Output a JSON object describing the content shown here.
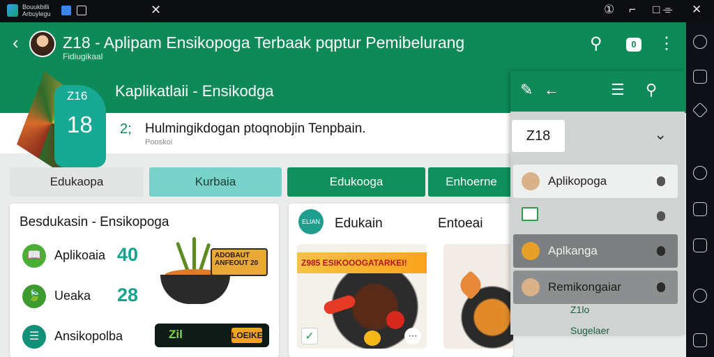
{
  "os": {
    "logo_text": "Bouukbilli Arbuylegu",
    "buttons": [
      "①",
      "⌐",
      "□ ⌯",
      "✕"
    ],
    "tab_close": "✕"
  },
  "appbar": {
    "title": "Z18 - Aplipam Ensikopoga Terbaak pqptur Pemibelurang",
    "subtitle": "Fidiugikaal",
    "badge": "0"
  },
  "banner": {
    "title": "Kaplikatlaii - Ensikodga",
    "hero_card_top": "Z16",
    "hero_card_number": "18"
  },
  "infocard": {
    "number": "2;",
    "text": "Hulmingikdogan ptoqnobjin Tenpbain.",
    "sub": "Pooskoi"
  },
  "tabs": [
    "Edukaopa",
    "Kurbaia",
    "Edukooga",
    "Enhoerne"
  ],
  "left_panel": {
    "title": "Besdukasin - Ensikopoga",
    "rows": [
      {
        "label": "Aplikoaia",
        "value": "40",
        "icon": "📖"
      },
      {
        "label": "Ueaka",
        "value": "28",
        "icon": "🍃"
      },
      {
        "label": "Ansikopolba",
        "value": "",
        "icon": "☰"
      }
    ],
    "sign1": "ADOBAUT ANFEOUT 20",
    "sign2_left": "Zil",
    "sign2_right": "LOEIKE"
  },
  "mid_panel": {
    "icon_text": "ELIAN",
    "title": "Edukain",
    "title2": "Entoeai",
    "banner_strip": "Z985 ESIKOOOGATARKEI!",
    "check": "✓",
    "bubble": "⋯"
  },
  "drawer": {
    "chip": "Z18",
    "items": [
      {
        "label": "Aplikopoga"
      },
      {
        "label": ""
      },
      {
        "label": "Aplkanga"
      },
      {
        "label": "Remikongaiar"
      }
    ],
    "small1": "Z1lo",
    "small2": "Sugelaer"
  },
  "colors": {
    "primary": "#0d8a57",
    "teal": "#18a995",
    "tab_active": "#79d2c9"
  }
}
